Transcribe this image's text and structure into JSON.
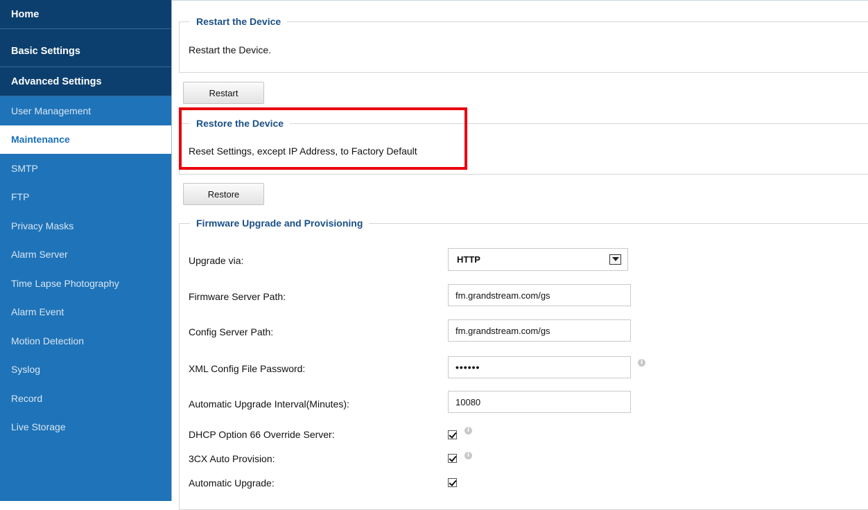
{
  "sidebar": {
    "home": "Home",
    "basic": "Basic Settings",
    "advanced": "Advanced Settings",
    "items": [
      {
        "label": "User Management"
      },
      {
        "label": "Maintenance"
      },
      {
        "label": "SMTP"
      },
      {
        "label": "FTP"
      },
      {
        "label": "Privacy Masks"
      },
      {
        "label": "Alarm Server"
      },
      {
        "label": "Time Lapse Photography"
      },
      {
        "label": "Alarm Event"
      },
      {
        "label": "Motion Detection"
      },
      {
        "label": "Syslog"
      },
      {
        "label": "Record"
      },
      {
        "label": "Live Storage"
      }
    ],
    "active": "Maintenance",
    "colors": {
      "bg": "#1f73b8",
      "header": "#0c3f6e",
      "active_text": "#1a6fb8"
    }
  },
  "restart": {
    "title": "Restart the Device",
    "desc": "Restart the Device.",
    "button": "Restart"
  },
  "restore": {
    "title": "Restore the Device",
    "desc": "Reset Settings, except IP Address, to Factory Default",
    "button": "Restore",
    "highlight_color": "#e8000b"
  },
  "firmware": {
    "title": "Firmware Upgrade and Provisioning",
    "upgrade_via": {
      "label": "Upgrade via:",
      "value": "HTTP"
    },
    "firmware_path": {
      "label": "Firmware Server Path:",
      "value": "fm.grandstream.com/gs"
    },
    "config_path": {
      "label": "Config Server Path:",
      "value": "fm.grandstream.com/gs"
    },
    "xml_password": {
      "label": "XML Config File Password:",
      "value": "••••••"
    },
    "interval": {
      "label": "Automatic Upgrade Interval(Minutes):",
      "value": "10080"
    },
    "dhcp66": {
      "label": "DHCP Option 66 Override Server:",
      "checked": true
    },
    "cx_auto": {
      "label": "3CX Auto Provision:",
      "checked": true
    },
    "auto_upgrade": {
      "label": "Automatic Upgrade:",
      "checked": true
    },
    "info_icon": "i"
  }
}
